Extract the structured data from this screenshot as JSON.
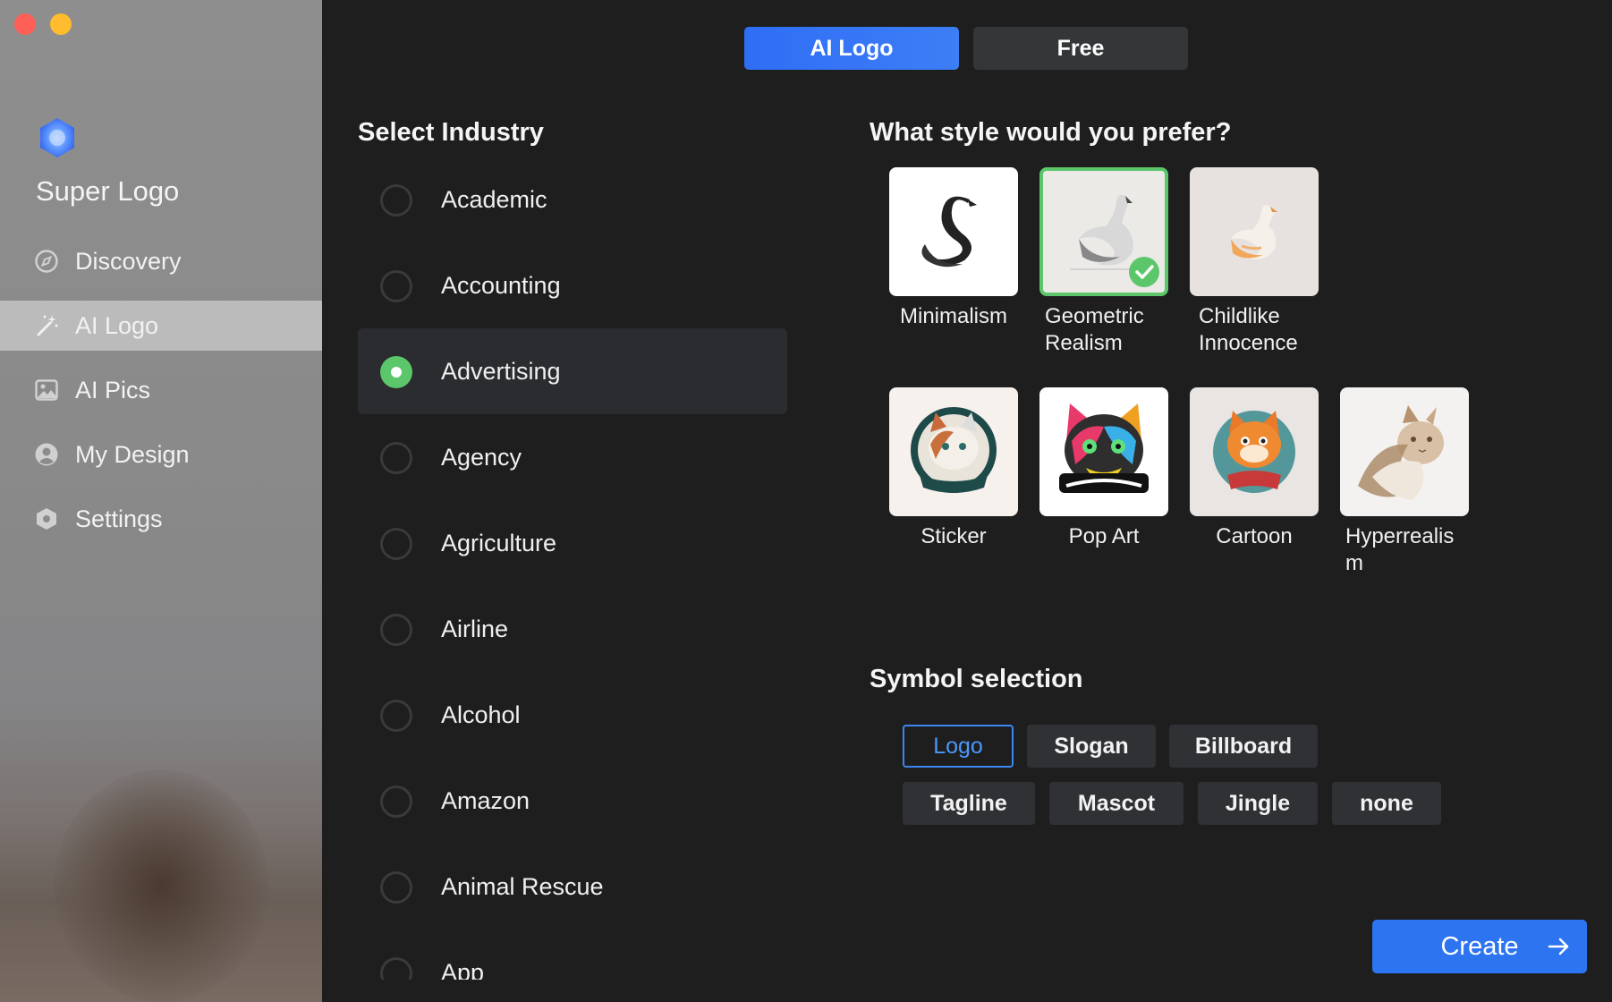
{
  "app": {
    "name": "Super Logo",
    "icon": "hexagon-app-icon"
  },
  "colors": {
    "accent_blue": "#2f6ef5",
    "selected_green": "#5cc76a",
    "main_bg": "#1e1e1e"
  },
  "sidebar": {
    "items": [
      {
        "label": "Discovery",
        "icon": "compass-icon",
        "active": false
      },
      {
        "label": "AI Logo",
        "icon": "magic-wand-icon",
        "active": true
      },
      {
        "label": "AI Pics",
        "icon": "image-icon",
        "active": false
      },
      {
        "label": "My Design",
        "icon": "user-circle-icon",
        "active": false
      },
      {
        "label": "Settings",
        "icon": "hexagon-gear-icon",
        "active": false
      }
    ]
  },
  "top_tabs": [
    {
      "label": "AI Logo",
      "active": true
    },
    {
      "label": "Free",
      "active": false
    }
  ],
  "industry": {
    "title": "Select Industry",
    "selected": "Advertising",
    "items": [
      "Academic",
      "Accounting",
      "Advertising",
      "Agency",
      "Agriculture",
      "Airline",
      "Alcohol",
      "Amazon",
      "Animal Rescue",
      "App"
    ]
  },
  "style": {
    "title": "What style would you prefer?",
    "selected": "Geometric Realism",
    "items": [
      {
        "label": "Minimalism",
        "thumb": "swan-minimal"
      },
      {
        "label": "Geometric\nRealism",
        "thumb": "swan-geometric"
      },
      {
        "label": "Childlike\nInnocence",
        "thumb": "swan-childlike"
      },
      {
        "label": "Sticker",
        "thumb": "cat-sticker"
      },
      {
        "label": "Pop Art",
        "thumb": "cat-popart"
      },
      {
        "label": "Cartoon",
        "thumb": "cat-cartoon"
      },
      {
        "label": "Hyperrealis\nm",
        "thumb": "cat-hyperreal"
      }
    ]
  },
  "symbol": {
    "title": "Symbol selection",
    "selected": "Logo",
    "options": [
      "Logo",
      "Slogan",
      "Billboard",
      "Tagline",
      "Mascot",
      "Jingle",
      "none"
    ]
  },
  "create_button": {
    "label": "Create",
    "icon": "arrow-right-icon"
  }
}
